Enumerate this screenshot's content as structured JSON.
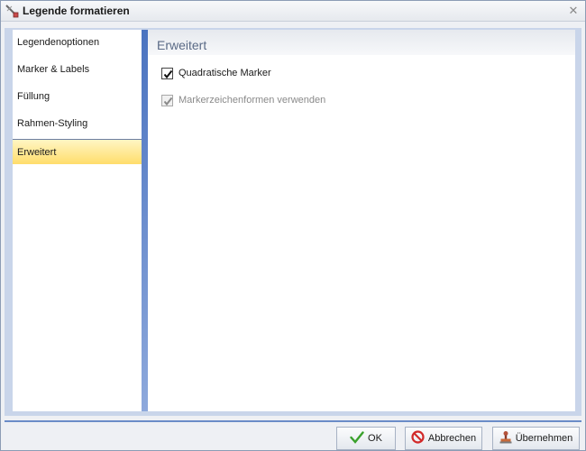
{
  "window": {
    "title": "Legende formatieren"
  },
  "nav": {
    "items": [
      {
        "label": "Legendenoptionen",
        "active": false
      },
      {
        "label": "Marker & Labels",
        "active": false
      },
      {
        "label": "Füllung",
        "active": false
      },
      {
        "label": "Rahmen-Styling",
        "active": false
      },
      {
        "label": "Erweitert",
        "active": true
      }
    ]
  },
  "panel": {
    "title": "Erweitert",
    "options": [
      {
        "label": "Quadratische Marker",
        "checked": true,
        "enabled": true
      },
      {
        "label": "Markerzeichenformen verwenden",
        "checked": true,
        "enabled": false
      }
    ]
  },
  "buttons": {
    "ok": "OK",
    "cancel": "Abbrechen",
    "apply": "Übernehmen"
  },
  "colors": {
    "accent": "#4a73c0",
    "active_nav": "#ffdd6b",
    "ok_check": "#3aa12c",
    "cancel_red": "#d22a2a"
  },
  "icons": {
    "title": "format-brush-icon",
    "close": "close-icon",
    "ok": "checkmark-icon",
    "cancel": "no-entry-icon",
    "apply": "stamp-icon"
  }
}
